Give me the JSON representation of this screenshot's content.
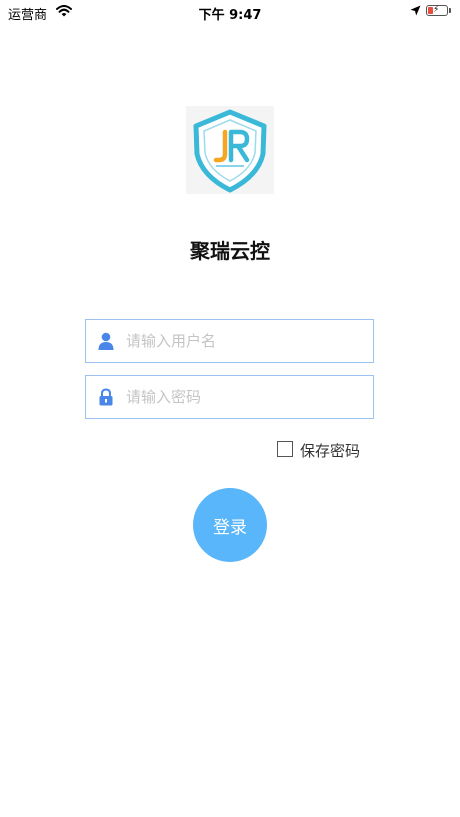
{
  "status_bar": {
    "carrier": "运营商",
    "time": "下午 9:47",
    "battery_level": 0.25,
    "battery_color": "#e74c3c",
    "icons": [
      "wifi-icon",
      "location-arrow-icon",
      "battery-charging-icon"
    ]
  },
  "app": {
    "title": "聚瑞云控",
    "logo_icon": "jr-shield-logo"
  },
  "form": {
    "username": {
      "value": "",
      "placeholder": "请输入用户名",
      "icon": "user-icon"
    },
    "password": {
      "value": "",
      "placeholder": "请输入密码",
      "icon": "lock-icon"
    },
    "remember_password": {
      "label": "保存密码",
      "checked": false
    },
    "login_button": {
      "label": "登录"
    }
  },
  "colors": {
    "accent": "#59b6fa",
    "field_border": "#9cc3f0",
    "icon_blue": "#4a86e8",
    "logo_cyan": "#3ab8d8",
    "logo_orange": "#f5a623"
  }
}
